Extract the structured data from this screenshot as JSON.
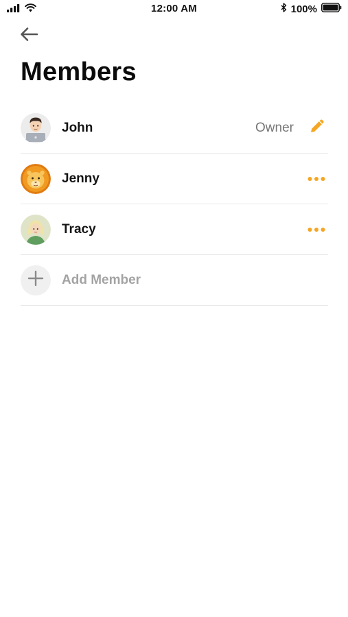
{
  "status_bar": {
    "time": "12:00 AM",
    "battery_percent": "100%",
    "icons": [
      "signal-icon",
      "wifi-icon",
      "bluetooth-icon",
      "battery-icon"
    ]
  },
  "header": {
    "back_icon": "back-arrow-icon",
    "title": "Members"
  },
  "members": [
    {
      "name": "John",
      "role": "Owner",
      "avatar": "person-with-laptop",
      "action_icon": "pencil-icon"
    },
    {
      "name": "Jenny",
      "role": "",
      "avatar": "lion-face",
      "action_icon": "more-icon"
    },
    {
      "name": "Tracy",
      "role": "",
      "avatar": "elf",
      "action_icon": "more-icon"
    }
  ],
  "add_member": {
    "label": "Add Member",
    "icon": "plus-icon"
  },
  "colors": {
    "accent": "#F5A623",
    "text_primary": "#111111",
    "text_secondary": "#777777",
    "text_muted": "#A3A3A3",
    "divider": "#E8E8E8"
  }
}
